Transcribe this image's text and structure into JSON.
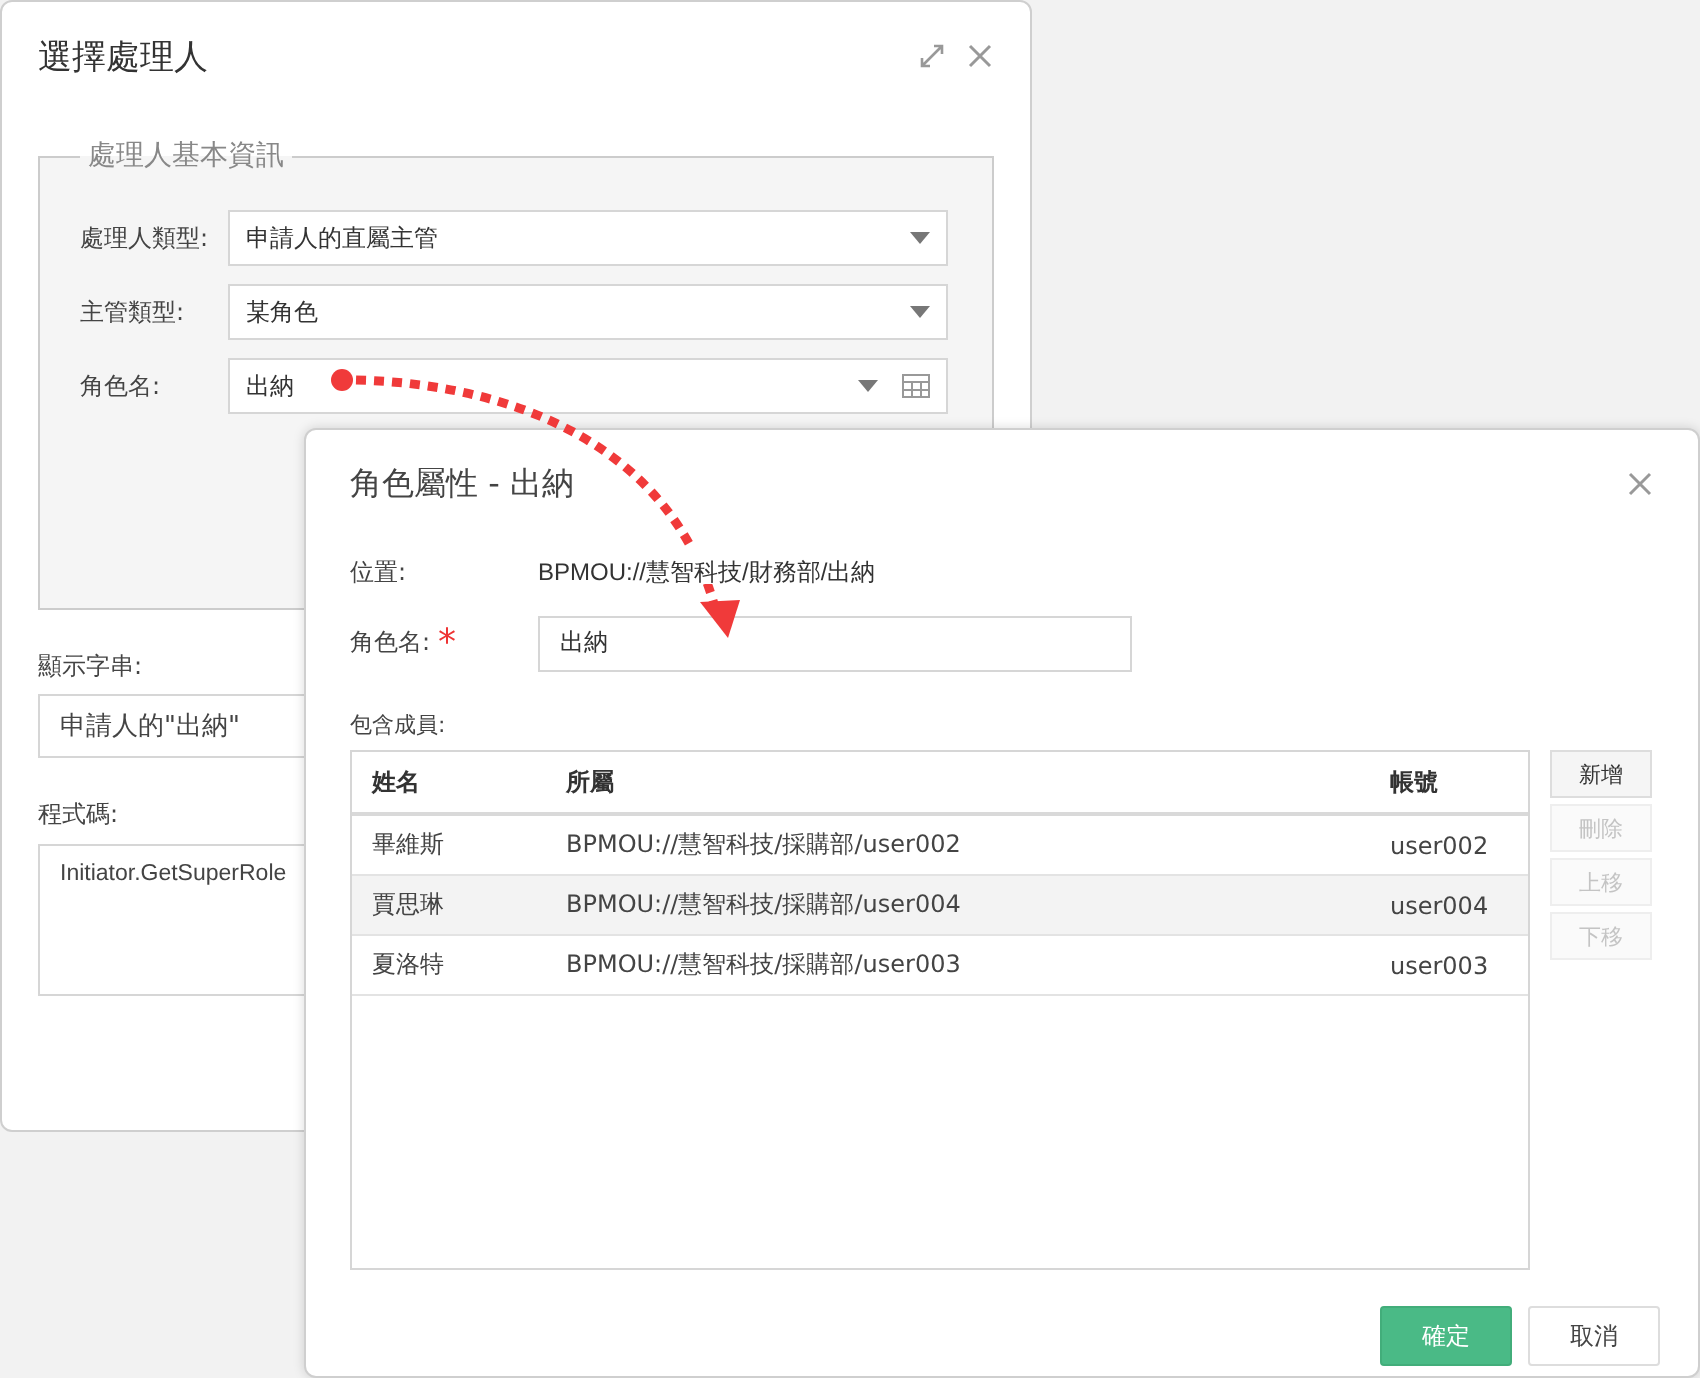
{
  "back_dialog": {
    "title": "選擇處理人",
    "section_legend": "處理人基本資訊",
    "fields": [
      {
        "label": "處理人類型:",
        "value": "申請人的直屬主管",
        "kind": "dropdown"
      },
      {
        "label": "主管類型:",
        "value": "某角色",
        "kind": "dropdown"
      },
      {
        "label": "角色名:",
        "value": "出納",
        "kind": "picker"
      }
    ],
    "display_label": "顯示字串:",
    "display_value": "申請人的\"出納\"",
    "code_label": "程式碼:",
    "code_value": "Initiator.GetSuperRole"
  },
  "front_dialog": {
    "title": "角色屬性 - 出納",
    "location_label": "位置:",
    "location_value": "BPMOU://慧智科技/財務部/出納",
    "role_label": "角色名:",
    "required_mark": "*",
    "role_value": "出納",
    "members_label": "包含成員:",
    "columns": [
      "姓名",
      "所屬",
      "帳號"
    ],
    "rows": [
      {
        "cells": [
          "畢維斯",
          "BPMOU://慧智科技/採購部/user002",
          "user002"
        ],
        "selected": false
      },
      {
        "cells": [
          "賈思琳",
          "BPMOU://慧智科技/採購部/user004",
          "user004"
        ],
        "selected": true
      },
      {
        "cells": [
          "夏洛特",
          "BPMOU://慧智科技/採購部/user003",
          "user003"
        ],
        "selected": false
      }
    ],
    "side_buttons": [
      {
        "label": "新增",
        "disabled": false
      },
      {
        "label": "刪除",
        "disabled": true
      },
      {
        "label": "上移",
        "disabled": true
      },
      {
        "label": "下移",
        "disabled": true
      }
    ],
    "ok": "確定",
    "cancel": "取消"
  }
}
